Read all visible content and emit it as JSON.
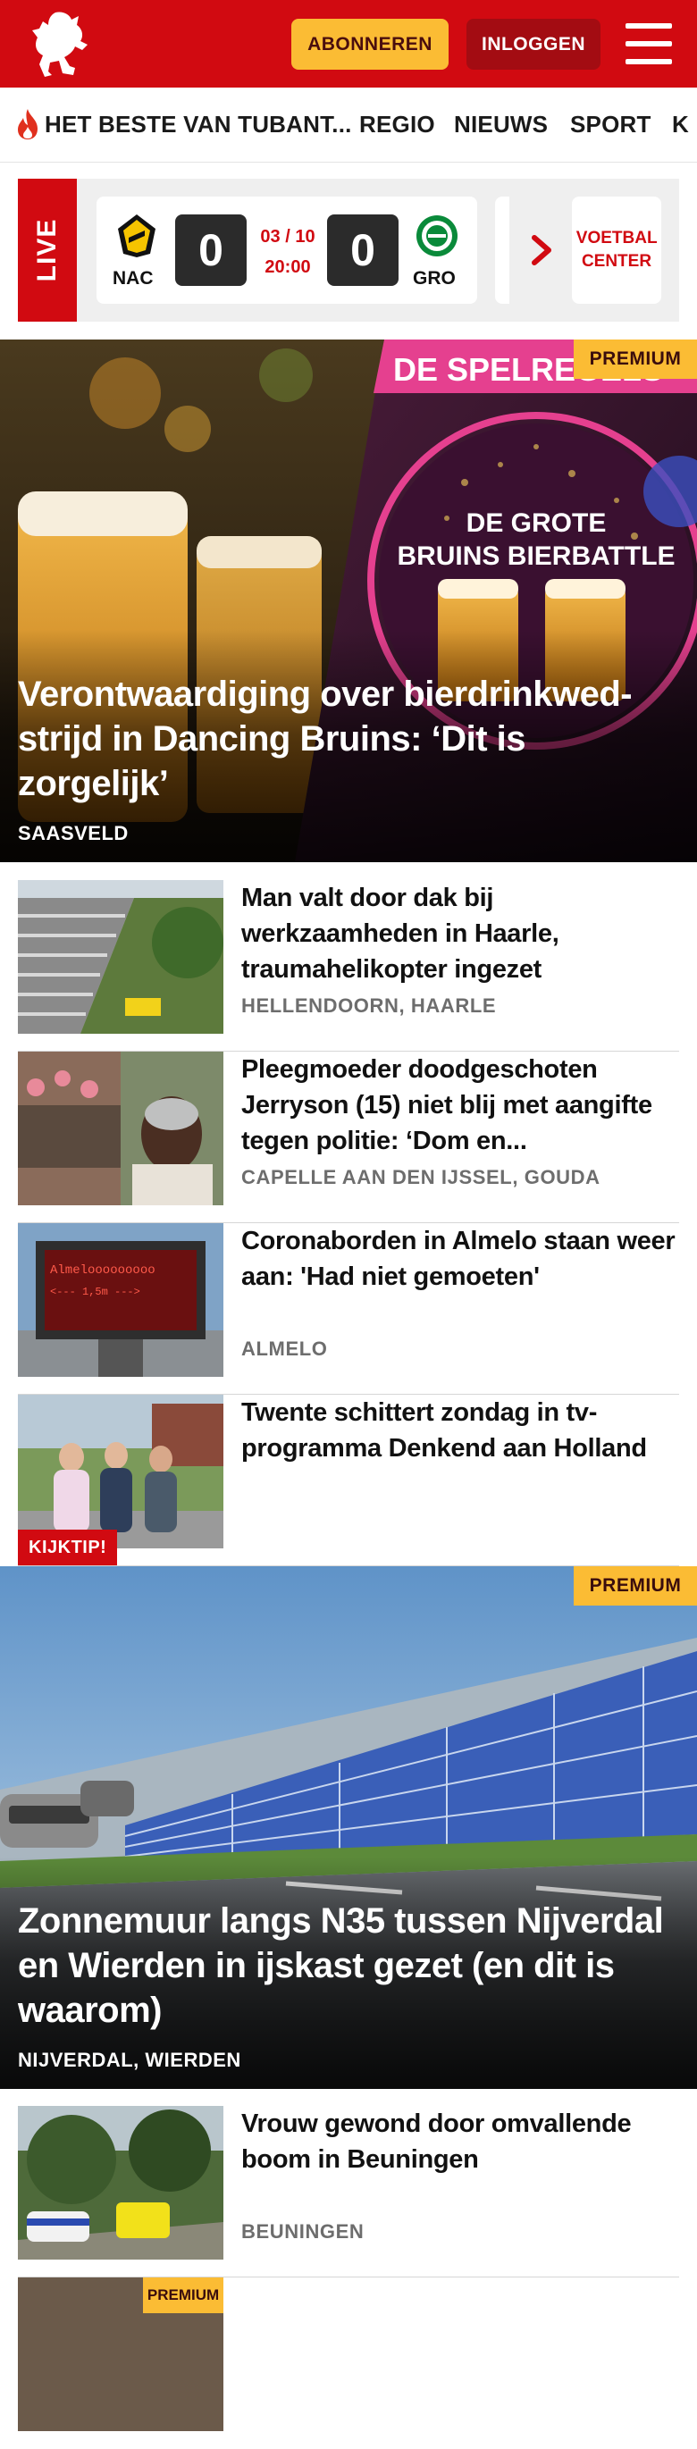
{
  "header": {
    "logo_icon": "tubantia-horse-logo-icon",
    "subscribe_label": "ABONNEREN",
    "login_label": "INLOGGEN",
    "menu_icon": "hamburger-menu-icon",
    "brand_color": "#d10a11",
    "accent_color": "#fbbc34"
  },
  "nav": {
    "items": [
      {
        "label": "HET BESTE VAN TUBANT...",
        "icon": "flame-icon"
      },
      {
        "label": "REGIO"
      },
      {
        "label": "NIEUWS"
      },
      {
        "label": "SPORT"
      },
      {
        "label": "K"
      }
    ]
  },
  "live": {
    "label": "LIVE",
    "match": {
      "home": "NAC",
      "away": "GRO",
      "home_score": "0",
      "away_score": "0",
      "date": "03 / 10",
      "time": "20:00"
    },
    "next_icon": "chevron-right-icon",
    "voetbal_center": "VOETBAL CENTER"
  },
  "hero1": {
    "premium": "PREMIUM",
    "title": "Verontwaardiging over bierdrinkwed­strijd in Dancing Bruins: ‘Dit is zorgelijk’",
    "location": "SAASVELD",
    "sign_top": "DE SPELREGELS",
    "sign_main": "DE  GROTE\nBRUINS BIERBATTLE"
  },
  "articles": [
    {
      "title": "Man valt door dak bij werkzaamheden in Haarle, traumahelikopter ingezet",
      "location": "HELLENDOORN, HAARLE"
    },
    {
      "title": "Pleegmoeder doodgeschoten Jerryson (15) niet blij met aangifte tegen politie: ‘Dom en...",
      "location": "CAPELLE AAN DEN IJSSEL, GOUDA"
    },
    {
      "title": "Coronaborden in Almelo staan weer aan: 'Had niet gemoeten'",
      "location": "ALMELO",
      "sign_text": "Almelooooooooo",
      "sign_text2": "<--- 1,5m --->"
    },
    {
      "title": "Twente schittert zondag in tv-programma Denkend aan Holland",
      "location": "",
      "badge": "KIJKTIP!"
    }
  ],
  "hero2": {
    "premium": "PREMIUM",
    "title": "Zonnemuur langs N35 tussen Nijverdal en Wierden in ijskast gezet (en dit is waarom)",
    "location": "NIJVERDAL, WIERDEN"
  },
  "articles2": [
    {
      "title": "Vrouw gewond door omvallende boom in Beuningen",
      "location": "BEUNINGEN"
    },
    {
      "badge": "PREMIUM"
    }
  ]
}
